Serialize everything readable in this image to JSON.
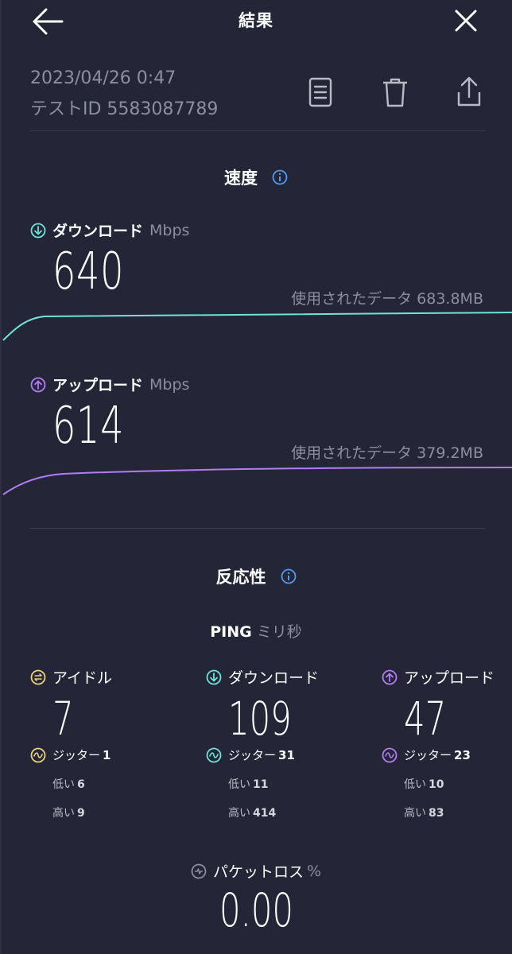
{
  "header": {
    "title": "結果"
  },
  "meta": {
    "datetime": "2023/04/26 0:47",
    "test_id": "テストID 5583087789"
  },
  "speed": {
    "title": "速度",
    "download": {
      "label": "ダウンロード",
      "unit": "Mbps",
      "value": "640",
      "data_used": "使用されたデータ 683.8MB",
      "color": "#6fe3d8"
    },
    "upload": {
      "label": "アップロード",
      "unit": "Mbps",
      "value": "614",
      "data_used": "使用されたデータ 379.2MB",
      "color": "#b37cf2"
    }
  },
  "responsiveness": {
    "title": "反応性",
    "ping_label": "PING",
    "ping_unit": "ミリ秒",
    "columns": [
      {
        "label": "アイドル",
        "value": "7",
        "jitter_label": "ジッター",
        "jitter": "1",
        "low_label": "低い",
        "low": "6",
        "high_label": "高い",
        "high": "9",
        "color": "#e9d27a"
      },
      {
        "label": "ダウンロード",
        "value": "109",
        "jitter_label": "ジッター",
        "jitter": "31",
        "low_label": "低い",
        "low": "11",
        "high_label": "高い",
        "high": "414",
        "color": "#6fe3d8"
      },
      {
        "label": "アップロード",
        "value": "47",
        "jitter_label": "ジッター",
        "jitter": "23",
        "low_label": "低い",
        "low": "10",
        "high_label": "高い",
        "high": "83",
        "color": "#b37cf2"
      }
    ],
    "packet_loss": {
      "label": "パケットロス",
      "unit": "%",
      "value": "0.00"
    }
  },
  "colors": {
    "background": "#242637",
    "info_blue": "#4f9bf0",
    "muted": "#8d8f9c"
  },
  "icons": [
    "back-arrow-icon",
    "close-icon",
    "document-icon",
    "trash-icon",
    "share-icon",
    "info-icon",
    "download-arrow-icon",
    "upload-arrow-icon",
    "idle-icon",
    "jitter-icon",
    "packet-loss-icon"
  ]
}
